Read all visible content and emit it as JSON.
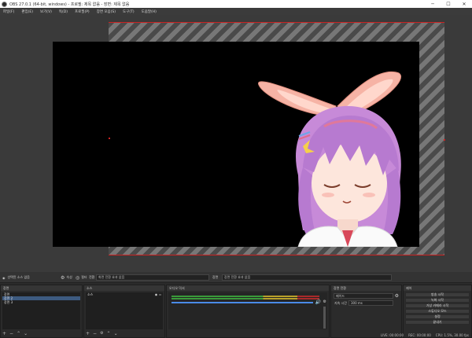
{
  "window": {
    "title": "OBS 27.0.1 (64-bit, windows) - 프로필: 제목 없음 - 장면: 제목 없음"
  },
  "menu": [
    "파일(F)",
    "편집(E)",
    "보기(V)",
    "독(D)",
    "프로필(P)",
    "장면 모음(S)",
    "도구(T)",
    "도움말(H)"
  ],
  "context_bar": {
    "no_source": "선택된 소스 없음",
    "properties": "속성",
    "filters": "필터",
    "transition_label": "전환",
    "transition_value": "화면 전환 효과 없음",
    "scene_label": "장면",
    "scene_value": "장면 전환 효과 없음"
  },
  "scenes": {
    "header": "장면",
    "items": [
      "장면",
      "장면 2",
      "장면 3"
    ]
  },
  "sources": {
    "header": "소스",
    "items": [
      "소스"
    ]
  },
  "mixer": {
    "header": "오디오 믹서",
    "level": 0.9
  },
  "transitions": {
    "header": "장면 전환",
    "type": "페이드",
    "duration_label": "지속 시간",
    "duration": "300 ms"
  },
  "controls": {
    "header": "제어",
    "buttons": [
      "방송 시작",
      "녹화 시작",
      "가상 카메라 시작",
      "스튜디오 모드",
      "설정",
      "끝내기"
    ]
  },
  "status": {
    "live": "LIVE: 00:00:00",
    "rec": "REC: 00:00:00",
    "cpu": "CPU: 1.5%, 30.00 fps"
  },
  "colors": {
    "accent_red": "#cc2222",
    "canvas_bg": "#000000",
    "panel_bg": "#2b2b2b",
    "selection": "#3d5a80"
  }
}
